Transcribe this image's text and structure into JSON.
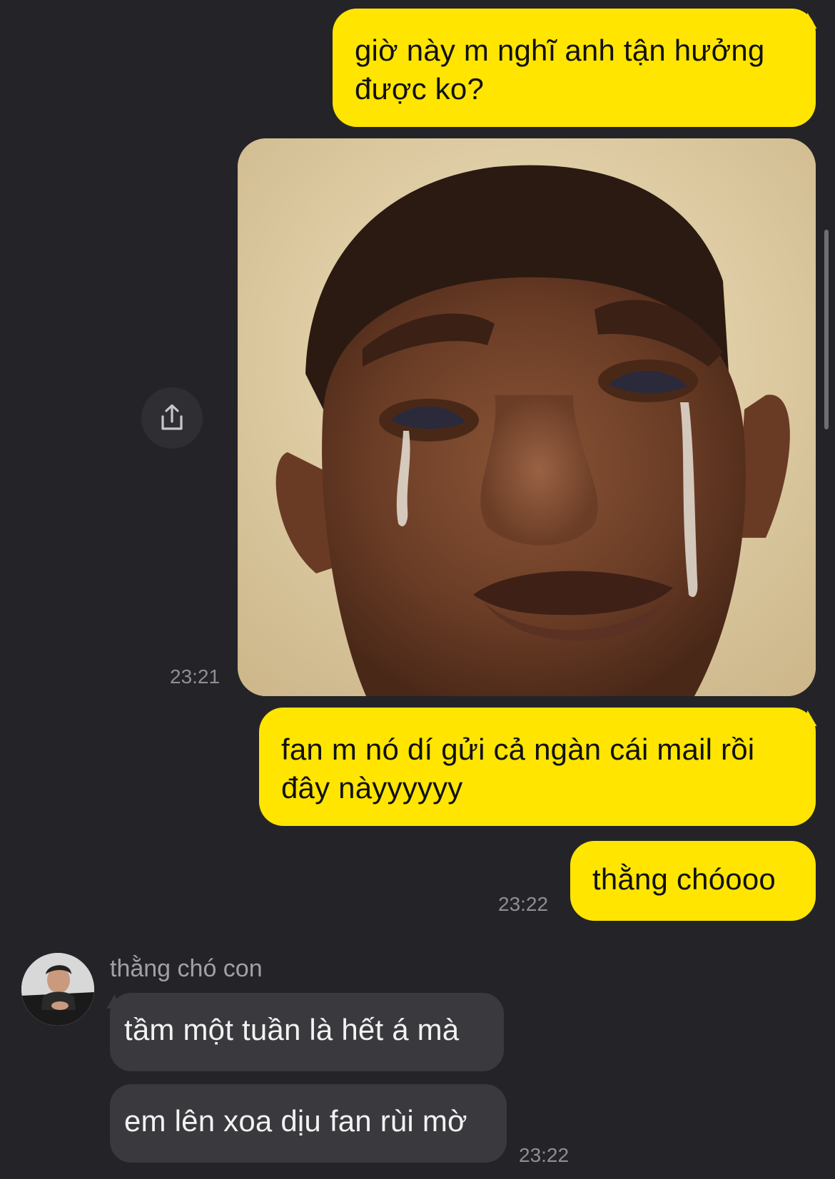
{
  "messages": [
    {
      "id": "m1",
      "direction": "outgoing",
      "text_line1": "giờ này m nghĩ anh tận hưởng",
      "text_line2": "được ko?"
    },
    {
      "id": "m2",
      "direction": "outgoing",
      "type": "image",
      "image_description": "crying-man-meme",
      "time": "23:21"
    },
    {
      "id": "m3",
      "direction": "outgoing",
      "text_line1": "fan m nó dí gửi cả ngàn cái mail rồi",
      "text_line2": "đây nàyyyyyy"
    },
    {
      "id": "m4",
      "direction": "outgoing",
      "text": "thằng chóooo",
      "time": "23:22"
    }
  ],
  "incoming": {
    "sender_name": "thằng chó con",
    "messages": [
      {
        "text": "tầm một tuần là hết á mà"
      },
      {
        "text": "em lên xoa dịu fan rùi mờ",
        "time": "23:22"
      }
    ]
  },
  "colors": {
    "background": "#242428",
    "outgoing_bubble": "#FFE500",
    "incoming_bubble": "#3A3A3E",
    "timestamp": "#8E8E93"
  },
  "icons": {
    "share": "share-icon",
    "avatar": "avatar"
  }
}
